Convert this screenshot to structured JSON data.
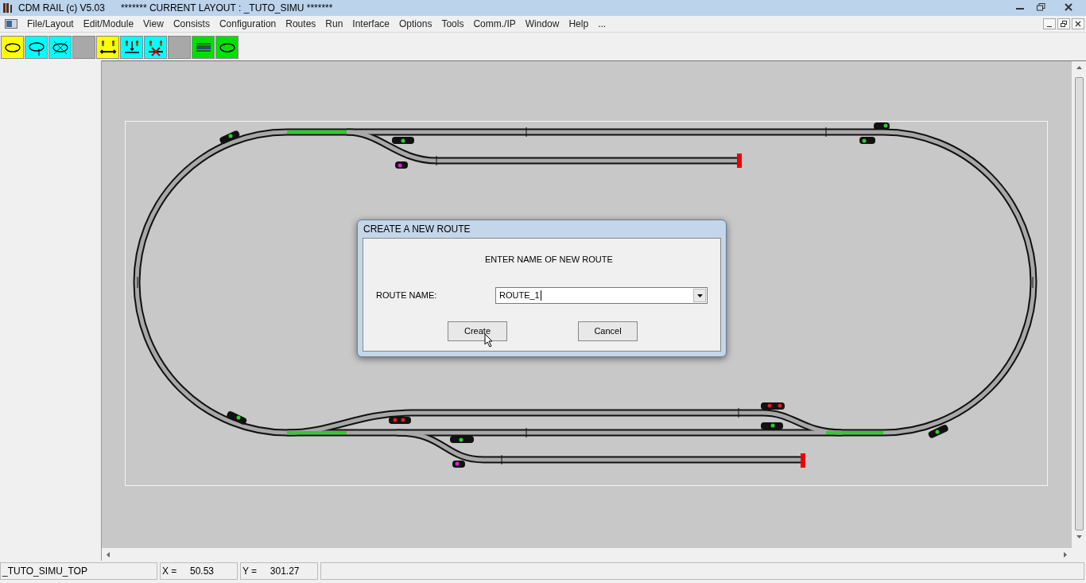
{
  "window": {
    "title": "CDM RAIL (c) V5.03      ******* CURRENT LAYOUT : _TUTO_SIMU *******"
  },
  "menu": [
    "File/Layout",
    "Edit/Module",
    "View",
    "Consists",
    "Configuration",
    "Routes",
    "Run",
    "Interface",
    "Options",
    "Tools",
    "Comm./IP",
    "Window",
    "Help",
    "..."
  ],
  "toolbar": [
    {
      "kind": "loop",
      "color": "#ffff00"
    },
    {
      "kind": "loop-arrow",
      "color": "#00ffff"
    },
    {
      "kind": "loop-cross",
      "color": "#00ffff"
    },
    {
      "kind": "blank",
      "color": "#a8a8a8"
    },
    {
      "kind": "signals-arrow",
      "color": "#ffff00"
    },
    {
      "kind": "signals-down",
      "color": "#00ffff"
    },
    {
      "kind": "signals-cross",
      "color": "#00ffff"
    },
    {
      "kind": "blank",
      "color": "#a8a8a8"
    },
    {
      "kind": "lines",
      "color": "#00e000"
    },
    {
      "kind": "loop",
      "color": "#00e000"
    }
  ],
  "dialog": {
    "title": "CREATE A NEW ROUTE",
    "prompt": "ENTER NAME OF NEW ROUTE",
    "label": "ROUTE NAME:",
    "value": "ROUTE_1",
    "buttons": [
      "Create",
      "Cancel"
    ]
  },
  "status_bar": [
    "_TUTO_SIMU_TOP",
    "X =     50.53",
    "Y =     301.27"
  ]
}
